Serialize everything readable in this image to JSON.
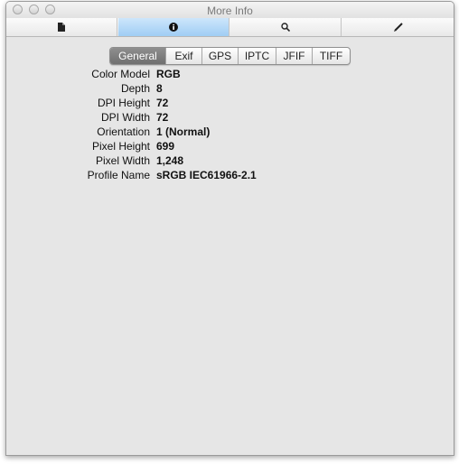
{
  "window": {
    "title": "More Info"
  },
  "toolbar": {
    "buttons": [
      {
        "icon": "document-icon"
      },
      {
        "icon": "info-icon",
        "selected": true
      },
      {
        "icon": "search-icon"
      },
      {
        "icon": "pencil-icon"
      }
    ]
  },
  "tabs": [
    "General",
    "Exif",
    "GPS",
    "IPTC",
    "JFIF",
    "TIFF"
  ],
  "active_tab": "General",
  "properties": [
    {
      "key": "Color Model",
      "value": "RGB"
    },
    {
      "key": "Depth",
      "value": "8"
    },
    {
      "key": "DPI Height",
      "value": "72"
    },
    {
      "key": "DPI Width",
      "value": "72"
    },
    {
      "key": "Orientation",
      "value": "1 (Normal)"
    },
    {
      "key": "Pixel Height",
      "value": "699"
    },
    {
      "key": "Pixel Width",
      "value": "1,248"
    },
    {
      "key": "Profile Name",
      "value": "sRGB IEC61966-2.1"
    }
  ],
  "colors": {
    "toolbar_selected": "#9fcdf4",
    "segment_active": "#7a7a7a",
    "panel_bg": "#e6e6e6"
  }
}
